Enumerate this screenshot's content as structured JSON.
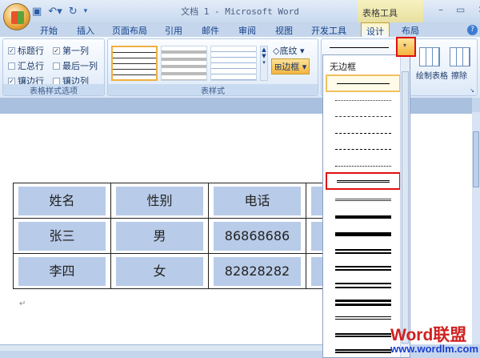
{
  "window": {
    "title": "文档 1 - Microsoft Word",
    "context_tab_group": "表格工具"
  },
  "tabs": [
    "开始",
    "插入",
    "页面布局",
    "引用",
    "邮件",
    "审阅",
    "视图",
    "开发工具",
    "设计",
    "布局"
  ],
  "active_tab": "设计",
  "options_group": {
    "label": "表格样式选项",
    "items": [
      {
        "label": "标题行",
        "checked": true
      },
      {
        "label": "第一列",
        "checked": true
      },
      {
        "label": "汇总行",
        "checked": false
      },
      {
        "label": "最后一列",
        "checked": false
      },
      {
        "label": "镶边行",
        "checked": true
      },
      {
        "label": "镶边列",
        "checked": false
      }
    ]
  },
  "styles_group": {
    "label": "表样式",
    "shading": "底纹",
    "borders": "边框"
  },
  "draw_group": {
    "draw_table": "绘制表格",
    "eraser": "擦除"
  },
  "dropdown": {
    "no_border": "无边框"
  },
  "table": {
    "rows": [
      [
        "姓名",
        "性别",
        "电话"
      ],
      [
        "张三",
        "男",
        "86868686"
      ],
      [
        "李四",
        "女",
        "82828282"
      ]
    ]
  },
  "watermark": {
    "brand": "Word联盟",
    "url": "www.wordlm.com"
  }
}
